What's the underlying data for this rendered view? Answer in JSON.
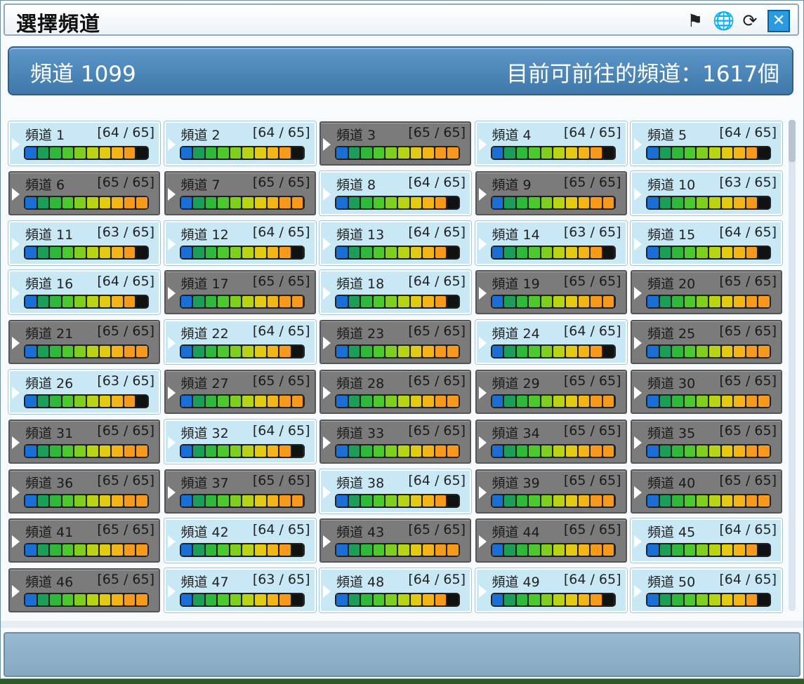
{
  "window": {
    "title": "選擇頻道",
    "icons": [
      "map-pin-icon",
      "globe-pin-icon",
      "refresh-icon",
      "close-icon"
    ]
  },
  "header": {
    "current_channel": "頻道 1099",
    "available_label": "目前可前往的頻道：1617個"
  },
  "channels": [
    {
      "name": "頻道 1",
      "count": "[64 / 65]",
      "full": false
    },
    {
      "name": "頻道 2",
      "count": "[64 / 65]",
      "full": false
    },
    {
      "name": "頻道 3",
      "count": "[65 / 65]",
      "full": true
    },
    {
      "name": "頻道 4",
      "count": "[64 / 65]",
      "full": false
    },
    {
      "name": "頻道 5",
      "count": "[64 / 65]",
      "full": false
    },
    {
      "name": "頻道 6",
      "count": "[65 / 65]",
      "full": true
    },
    {
      "name": "頻道 7",
      "count": "[65 / 65]",
      "full": true
    },
    {
      "name": "頻道 8",
      "count": "[64 / 65]",
      "full": false
    },
    {
      "name": "頻道 9",
      "count": "[65 / 65]",
      "full": true
    },
    {
      "name": "頻道 10",
      "count": "[63 / 65]",
      "full": false
    },
    {
      "name": "頻道 11",
      "count": "[63 / 65]",
      "full": false
    },
    {
      "name": "頻道 12",
      "count": "[64 / 65]",
      "full": false
    },
    {
      "name": "頻道 13",
      "count": "[64 / 65]",
      "full": false
    },
    {
      "name": "頻道 14",
      "count": "[63 / 65]",
      "full": false
    },
    {
      "name": "頻道 15",
      "count": "[64 / 65]",
      "full": false
    },
    {
      "name": "頻道 16",
      "count": "[64 / 65]",
      "full": false
    },
    {
      "name": "頻道 17",
      "count": "[65 / 65]",
      "full": true
    },
    {
      "name": "頻道 18",
      "count": "[64 / 65]",
      "full": false
    },
    {
      "name": "頻道 19",
      "count": "[65 / 65]",
      "full": true
    },
    {
      "name": "頻道 20",
      "count": "[65 / 65]",
      "full": true
    },
    {
      "name": "頻道 21",
      "count": "[65 / 65]",
      "full": true
    },
    {
      "name": "頻道 22",
      "count": "[64 / 65]",
      "full": false
    },
    {
      "name": "頻道 23",
      "count": "[65 / 65]",
      "full": true
    },
    {
      "name": "頻道 24",
      "count": "[64 / 65]",
      "full": false
    },
    {
      "name": "頻道 25",
      "count": "[65 / 65]",
      "full": true
    },
    {
      "name": "頻道 26",
      "count": "[63 / 65]",
      "full": false
    },
    {
      "name": "頻道 27",
      "count": "[65 / 65]",
      "full": true
    },
    {
      "name": "頻道 28",
      "count": "[65 / 65]",
      "full": true
    },
    {
      "name": "頻道 29",
      "count": "[65 / 65]",
      "full": true
    },
    {
      "name": "頻道 30",
      "count": "[65 / 65]",
      "full": true
    },
    {
      "name": "頻道 31",
      "count": "[65 / 65]",
      "full": true
    },
    {
      "name": "頻道 32",
      "count": "[64 / 65]",
      "full": false
    },
    {
      "name": "頻道 33",
      "count": "[65 / 65]",
      "full": true
    },
    {
      "name": "頻道 34",
      "count": "[65 / 65]",
      "full": true
    },
    {
      "name": "頻道 35",
      "count": "[65 / 65]",
      "full": true
    },
    {
      "name": "頻道 36",
      "count": "[65 / 65]",
      "full": true
    },
    {
      "name": "頻道 37",
      "count": "[65 / 65]",
      "full": true
    },
    {
      "name": "頻道 38",
      "count": "[64 / 65]",
      "full": false
    },
    {
      "name": "頻道 39",
      "count": "[65 / 65]",
      "full": true
    },
    {
      "name": "頻道 40",
      "count": "[65 / 65]",
      "full": true
    },
    {
      "name": "頻道 41",
      "count": "[65 / 65]",
      "full": true
    },
    {
      "name": "頻道 42",
      "count": "[64 / 65]",
      "full": false
    },
    {
      "name": "頻道 43",
      "count": "[65 / 65]",
      "full": true
    },
    {
      "name": "頻道 44",
      "count": "[65 / 65]",
      "full": true
    },
    {
      "name": "頻道 45",
      "count": "[64 / 65]",
      "full": false
    },
    {
      "name": "頻道 46",
      "count": "[65 / 65]",
      "full": true
    },
    {
      "name": "頻道 47",
      "count": "[63 / 65]",
      "full": false
    },
    {
      "name": "頻道 48",
      "count": "[64 / 65]",
      "full": false
    },
    {
      "name": "頻道 49",
      "count": "[64 / 65]",
      "full": false
    },
    {
      "name": "頻道 50",
      "count": "[64 / 65]",
      "full": false
    }
  ],
  "colors": {
    "bar_segments": [
      "#1a6fd6",
      "#1a9e58",
      "#2fb93a",
      "#4cc92c",
      "#7fcf1e",
      "#b9d415",
      "#e2cb12",
      "#f4b516",
      "#f79a1b"
    ],
    "available_tile": "#c9e8f6",
    "full_tile": "#7b7b7b",
    "header": "#4b86b9"
  }
}
